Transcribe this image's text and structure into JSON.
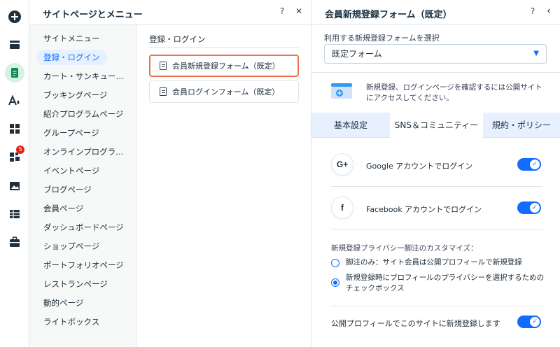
{
  "rail": {
    "icons": [
      "add-icon",
      "menus-icon",
      "pages-icon",
      "design-icon",
      "apps-icon",
      "business-apps-icon",
      "media-icon",
      "cms-icon",
      "portfolio-briefcase-icon"
    ],
    "apps_badge": "5",
    "accent": "#116dff",
    "active_bg": "#d6f2e3"
  },
  "panel1": {
    "title": "サイトページとメニュー",
    "help": "?",
    "close": "✕",
    "menu_items": [
      "サイトメニュー",
      "登録・ログイン",
      "カート・サンキュー…",
      "ブッキングページ",
      "紹介プログラムページ",
      "グループページ",
      "オンラインプログラ…",
      "イベントページ",
      "ブログページ",
      "会員ページ",
      "ダッシュボードページ",
      "ショップページ",
      "ポートフォリオページ",
      "レストランページ",
      "動的ページ",
      "ライトボックス"
    ],
    "section_label": "登録・ログイン",
    "pages": [
      "会員新規登録フォーム（既定）",
      "会員ログインフォーム（既定）"
    ]
  },
  "panel2": {
    "title": "会員新規登録フォーム（既定）",
    "help": "?",
    "back": "‹",
    "select_label": "利用する新規登録フォームを選択",
    "select_value": "既定フォーム",
    "info_text": "新規登録、ログインページを確認するには公開サイトにアクセスしてください。",
    "tabs": [
      "基本設定",
      "SNS＆コミュニティー",
      "規約・ポリシー"
    ],
    "rows": [
      {
        "icon": "G+",
        "label": "Google アカウントでログイン"
      },
      {
        "icon": "f",
        "label": "Facebook アカウントでログイン"
      }
    ],
    "privacy_heading": "新規登録プライバシー脚注のカスタマイズ：",
    "radios": [
      "脚注のみ：サイト会員は公開プロフィールで新規登録",
      "新規登録時にプロフィールのプライバシーを選択するためのチェックボックス"
    ],
    "public_profile_label": "公開プロフィールでこのサイトに新規登録します",
    "selected_border": "#f0714f"
  }
}
